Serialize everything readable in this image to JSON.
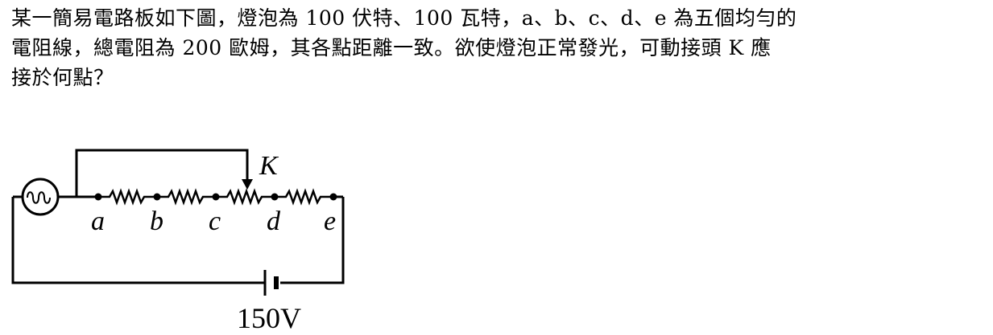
{
  "question": {
    "line1": "某一簡易電路板如下圖，燈泡為 100 伏特、100 瓦特，a、b、c、d、e 為五個均勻的",
    "line2": "電阻線，總電阻為 200 歐姆，其各點距離一致。欲使燈泡正常發光，可動接頭 K 應",
    "line3": "接於何點？"
  },
  "diagram": {
    "slider_label": "K",
    "points": [
      "a",
      "b",
      "c",
      "d",
      "e"
    ],
    "battery_voltage": "150V"
  }
}
